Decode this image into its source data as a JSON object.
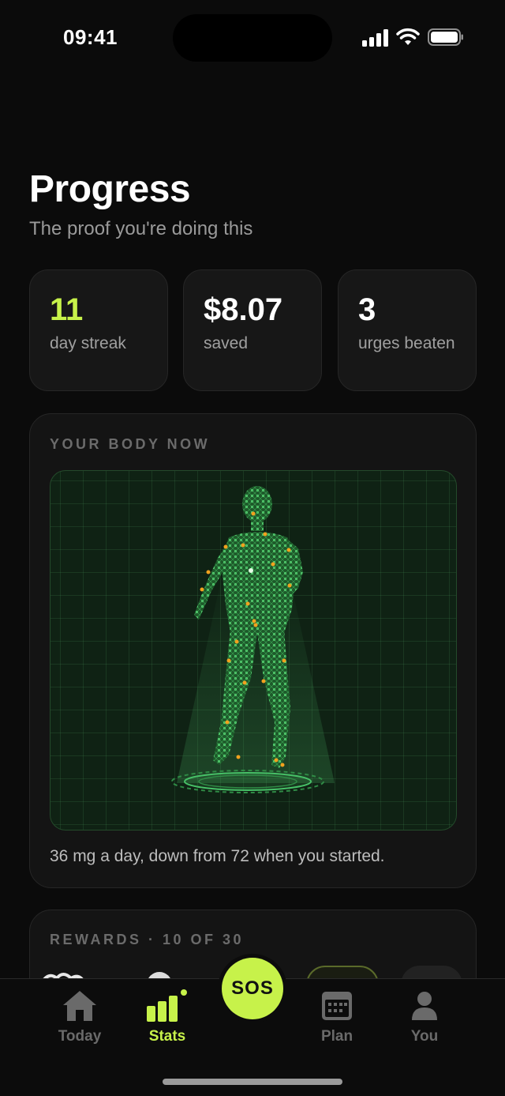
{
  "status_bar": {
    "time": "09:41",
    "icons": [
      "cellular-signal-icon",
      "wifi-icon",
      "battery-icon"
    ]
  },
  "header": {
    "title": "Progress",
    "subtitle": "The proof you're doing this"
  },
  "stats": [
    {
      "value": "11",
      "label": "day streak",
      "accent": true
    },
    {
      "value": "$8.07",
      "label": "saved",
      "accent": false
    },
    {
      "value": "3",
      "label": "urges beaten",
      "accent": false
    }
  ],
  "body_now": {
    "section_label": "YOUR BODY NOW",
    "caption": "36 mg a day, down from 72 when you started.",
    "figure_icon": "body-wireframe-hologram"
  },
  "rewards": {
    "section_label": "REWARDS · 10 OF 30"
  },
  "tab_bar": {
    "tabs": [
      {
        "label": "Today",
        "icon": "home-icon",
        "active": false
      },
      {
        "label": "Stats",
        "icon": "bar-chart-icon",
        "active": true
      },
      {
        "label": "Plan",
        "icon": "calendar-icon",
        "active": false
      },
      {
        "label": "You",
        "icon": "person-icon",
        "active": false
      }
    ],
    "sos_label": "SOS"
  },
  "colors": {
    "accent": "#c7f24a",
    "background": "#0b0b0b",
    "card": "#171717",
    "hologram": "#3fae5a",
    "nodes": "#f2a21e"
  }
}
